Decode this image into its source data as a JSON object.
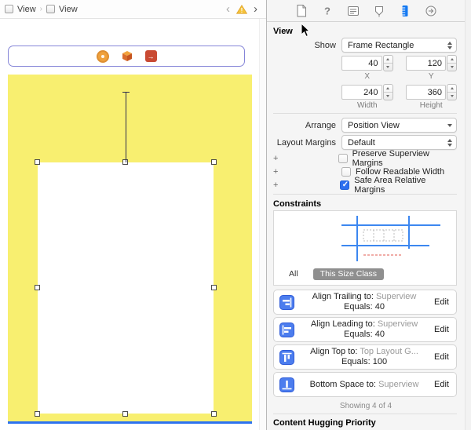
{
  "jumpbar": {
    "item1": "View",
    "item2": "View",
    "separator": "›",
    "back": "‹",
    "forward": "›"
  },
  "inspector": {
    "view": {
      "title": "View",
      "show_label": "Show",
      "show_value": "Frame Rectangle",
      "x_value": "40",
      "x_label": "X",
      "y_value": "120",
      "y_label": "Y",
      "width_value": "240",
      "width_label": "Width",
      "height_value": "360",
      "height_label": "Height",
      "arrange_label": "Arrange",
      "arrange_value": "Position View",
      "margins_label": "Layout Margins",
      "margins_value": "Default",
      "plus": "+",
      "checks": [
        {
          "label": "Preserve Superview Margins",
          "checked": false
        },
        {
          "label": "Follow Readable Width",
          "checked": false
        },
        {
          "label": "Safe Area Relative Margins",
          "checked": true
        }
      ]
    },
    "constraints": {
      "title": "Constraints",
      "tabs": [
        {
          "label": "All",
          "selected": false
        },
        {
          "label": "This Size Class",
          "selected": true
        }
      ],
      "items": [
        {
          "title": "Align Trailing to:",
          "target": "Superview",
          "equals_label": "Equals:",
          "equals_value": "40",
          "edit": "Edit"
        },
        {
          "title": "Align Leading to:",
          "target": "Superview",
          "equals_label": "Equals:",
          "equals_value": "40",
          "edit": "Edit"
        },
        {
          "title": "Align Top to:",
          "target": "Top Layout G...",
          "equals_label": "Equals:",
          "equals_value": "100",
          "edit": "Edit"
        },
        {
          "title": "Bottom Space to:",
          "target": "Superview",
          "edit": "Edit"
        }
      ],
      "showing": "Showing 4 of 4"
    },
    "footer_section_title": "Content Hugging Priority"
  },
  "colors": {
    "canvas_yellow": "#F8EF70",
    "constraint_blue": "#3C87F0",
    "accent_blue": "#1479F2",
    "selected_pill_gray": "#8F8F8F",
    "warning_yellow": "#F5A623"
  }
}
